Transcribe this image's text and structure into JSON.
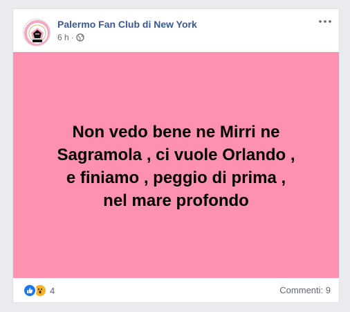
{
  "post": {
    "page_name": "Palermo Fan Club di New York",
    "time": "6 h",
    "separator": "·",
    "privacy_icon": "globe-icon",
    "more_icon": "more-options-icon",
    "text_line_1": "Non vedo bene ne Mirri ne",
    "text_line_2": "Sagramola , ci vuole Orlando ,",
    "text_line_3": "e finiamo , peggio di prima ,",
    "text_line_4": "nel mare profondo",
    "background_color": "#fe90b0"
  },
  "avatar": {
    "arc_text_top": "PALERMO FAN CLUB",
    "badge_text": "NEW YORK",
    "colors": {
      "pink": "#f4a7c0",
      "black": "#111111",
      "gold": "#b88a2d"
    }
  },
  "footer": {
    "reaction_icons": [
      "like-icon",
      "wow-icon"
    ],
    "reaction_count": "4",
    "comments_label": "Commenti: 9"
  },
  "colors": {
    "link": "#385898",
    "meta": "#616770",
    "like": "#1877f2",
    "wow": "#f7b125"
  }
}
